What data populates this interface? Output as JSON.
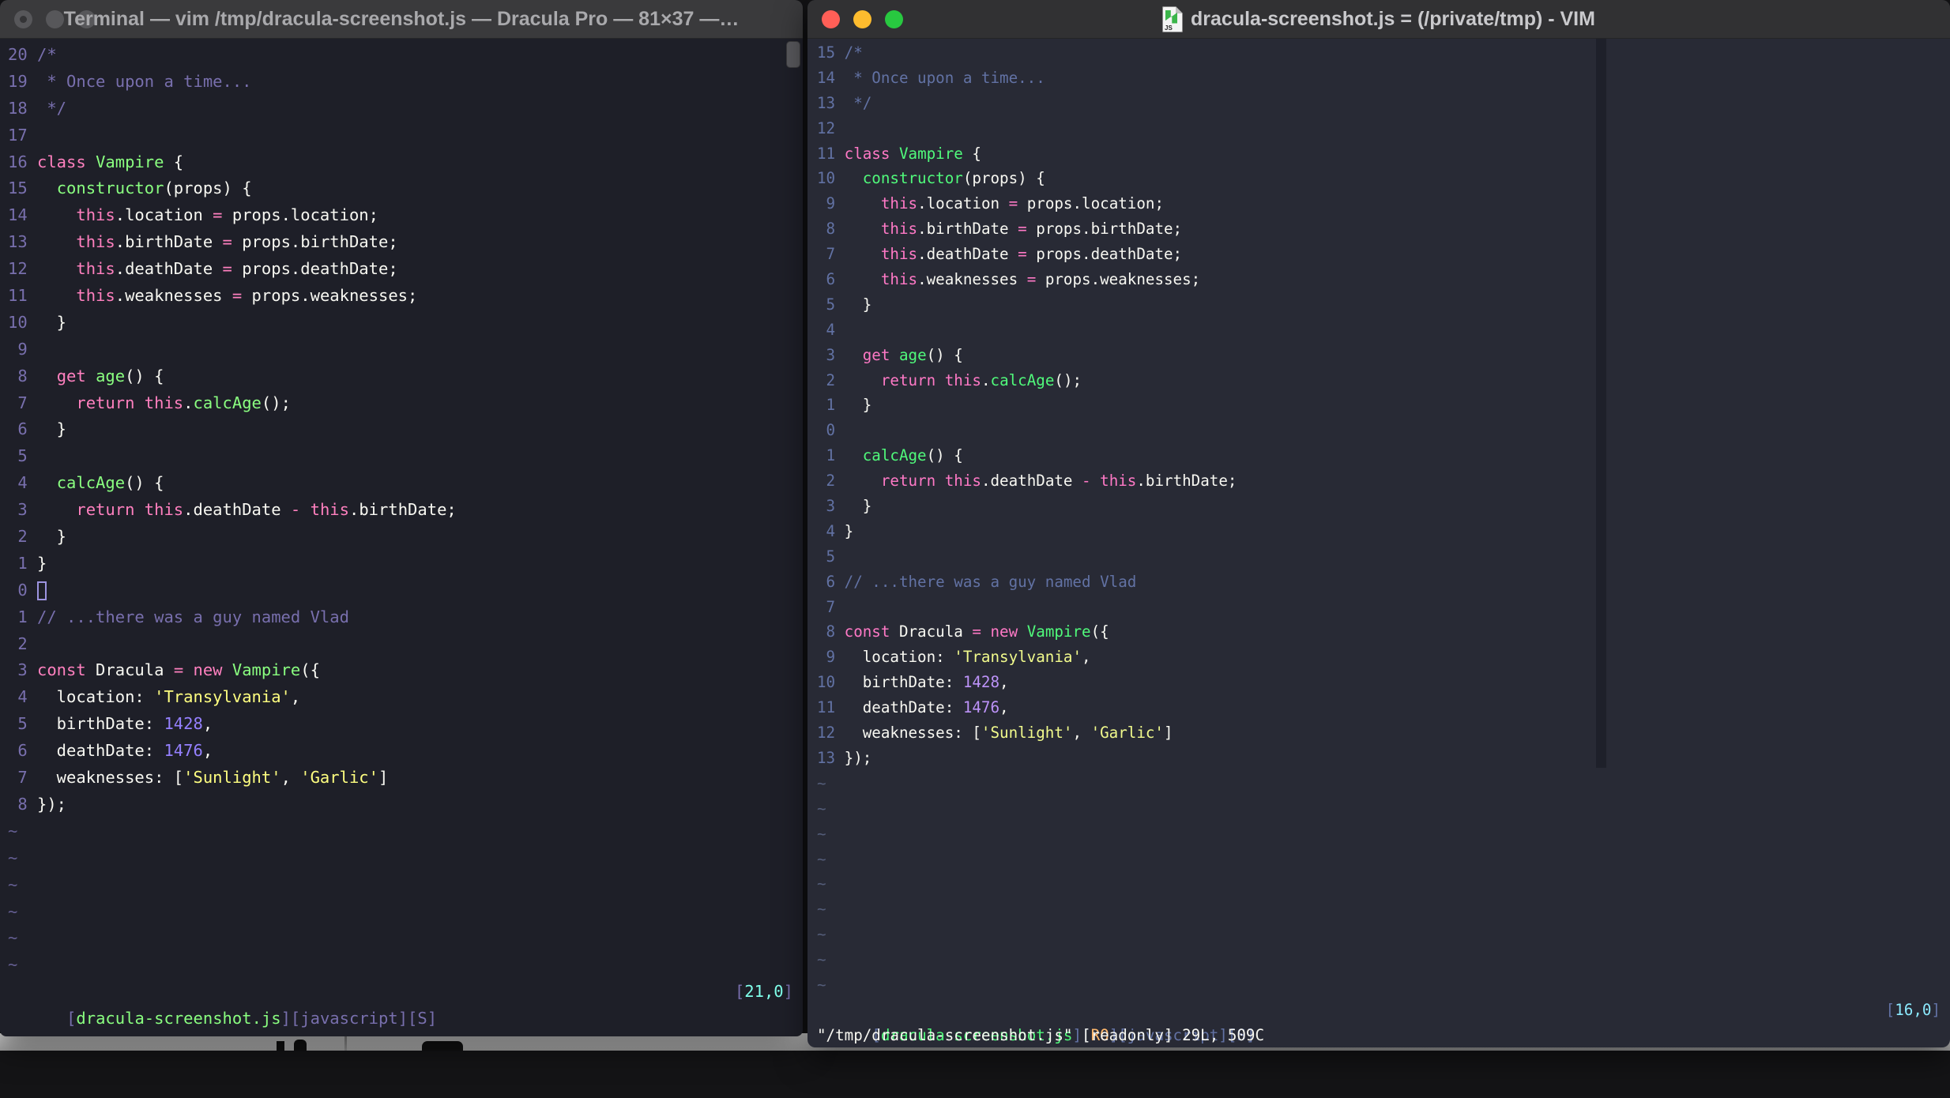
{
  "left_window": {
    "title": "Terminal — vim /tmp/dracula-screenshot.js — Dracula Pro — 81×37 —…",
    "palette": {
      "bg": "#1E1F28",
      "fg": "#F8F8F2",
      "comment": "#786FAD",
      "linenr": "#786FAD",
      "tilde": "#645E92",
      "pink": "#FF80BF",
      "green": "#8AFF80",
      "yellow": "#FFFF80",
      "purple": "#9580FF",
      "cyan": "#80FFEA",
      "orange": "#FFCA80"
    },
    "traffic_light_color": "#57575A",
    "lines": [
      {
        "n": "20",
        "s": [
          [
            "/*",
            "comment"
          ]
        ]
      },
      {
        "n": "19",
        "s": [
          [
            " * Once upon a time...",
            "comment"
          ]
        ]
      },
      {
        "n": "18",
        "s": [
          [
            " */",
            "comment"
          ]
        ]
      },
      {
        "n": "17",
        "s": []
      },
      {
        "n": "16",
        "s": [
          [
            "class",
            "pink"
          ],
          [
            " ",
            "fg"
          ],
          [
            "Vampire",
            "green"
          ],
          [
            " {",
            "fg"
          ]
        ]
      },
      {
        "n": "15",
        "s": [
          [
            "  ",
            "fg"
          ],
          [
            "constructor",
            "green"
          ],
          [
            "(props) {",
            "fg"
          ]
        ]
      },
      {
        "n": "14",
        "s": [
          [
            "    ",
            "fg"
          ],
          [
            "this",
            "pink"
          ],
          [
            ".location ",
            "fg"
          ],
          [
            "=",
            "pink"
          ],
          [
            " props.location;",
            "fg"
          ]
        ]
      },
      {
        "n": "13",
        "s": [
          [
            "    ",
            "fg"
          ],
          [
            "this",
            "pink"
          ],
          [
            ".birthDate ",
            "fg"
          ],
          [
            "=",
            "pink"
          ],
          [
            " props.birthDate;",
            "fg"
          ]
        ]
      },
      {
        "n": "12",
        "s": [
          [
            "    ",
            "fg"
          ],
          [
            "this",
            "pink"
          ],
          [
            ".deathDate ",
            "fg"
          ],
          [
            "=",
            "pink"
          ],
          [
            " props.deathDate;",
            "fg"
          ]
        ]
      },
      {
        "n": "11",
        "s": [
          [
            "    ",
            "fg"
          ],
          [
            "this",
            "pink"
          ],
          [
            ".weaknesses ",
            "fg"
          ],
          [
            "=",
            "pink"
          ],
          [
            " props.weaknesses;",
            "fg"
          ]
        ]
      },
      {
        "n": "10",
        "s": [
          [
            "  }",
            "fg"
          ]
        ]
      },
      {
        "n": " 9",
        "s": []
      },
      {
        "n": " 8",
        "s": [
          [
            "  ",
            "fg"
          ],
          [
            "get",
            "pink"
          ],
          [
            " ",
            "fg"
          ],
          [
            "age",
            "green"
          ],
          [
            "() {",
            "fg"
          ]
        ]
      },
      {
        "n": " 7",
        "s": [
          [
            "    ",
            "fg"
          ],
          [
            "return",
            "pink"
          ],
          [
            " ",
            "fg"
          ],
          [
            "this",
            "pink"
          ],
          [
            ".",
            "fg"
          ],
          [
            "calcAge",
            "green"
          ],
          [
            "();",
            "fg"
          ]
        ]
      },
      {
        "n": " 6",
        "s": [
          [
            "  }",
            "fg"
          ]
        ]
      },
      {
        "n": " 5",
        "s": []
      },
      {
        "n": " 4",
        "s": [
          [
            "  ",
            "fg"
          ],
          [
            "calcAge",
            "green"
          ],
          [
            "() {",
            "fg"
          ]
        ]
      },
      {
        "n": " 3",
        "s": [
          [
            "    ",
            "fg"
          ],
          [
            "return",
            "pink"
          ],
          [
            " ",
            "fg"
          ],
          [
            "this",
            "pink"
          ],
          [
            ".deathDate ",
            "fg"
          ],
          [
            "-",
            "pink"
          ],
          [
            " ",
            "fg"
          ],
          [
            "this",
            "pink"
          ],
          [
            ".birthDate;",
            "fg"
          ]
        ]
      },
      {
        "n": " 2",
        "s": [
          [
            "  }",
            "fg"
          ]
        ]
      },
      {
        "n": " 1",
        "s": [
          [
            "}",
            "fg"
          ]
        ]
      },
      {
        "n": " 0",
        "s": [],
        "cur": true
      },
      {
        "n": " 1",
        "s": [
          [
            "// ...there was a guy named Vlad",
            "comment"
          ]
        ]
      },
      {
        "n": " 2",
        "s": []
      },
      {
        "n": " 3",
        "s": [
          [
            "const",
            "pink"
          ],
          [
            " Dracula ",
            "fg"
          ],
          [
            "=",
            "pink"
          ],
          [
            " ",
            "fg"
          ],
          [
            "new",
            "pink"
          ],
          [
            " ",
            "fg"
          ],
          [
            "Vampire",
            "green"
          ],
          [
            "({",
            "fg"
          ]
        ]
      },
      {
        "n": " 4",
        "s": [
          [
            "  location: ",
            "fg"
          ],
          [
            "'Transylvania'",
            "yellow"
          ],
          [
            ",",
            "fg"
          ]
        ]
      },
      {
        "n": " 5",
        "s": [
          [
            "  birthDate: ",
            "fg"
          ],
          [
            "1428",
            "purple"
          ],
          [
            ",",
            "fg"
          ]
        ]
      },
      {
        "n": " 6",
        "s": [
          [
            "  deathDate: ",
            "fg"
          ],
          [
            "1476",
            "purple"
          ],
          [
            ",",
            "fg"
          ]
        ]
      },
      {
        "n": " 7",
        "s": [
          [
            "  weaknesses: [",
            "fg"
          ],
          [
            "'Sunlight'",
            "yellow"
          ],
          [
            ", ",
            "fg"
          ],
          [
            "'Garlic'",
            "yellow"
          ],
          [
            "]",
            "fg"
          ]
        ]
      },
      {
        "n": " 8",
        "s": [
          [
            "});",
            "fg"
          ]
        ]
      },
      {
        "t": 1
      },
      {
        "t": 1
      },
      {
        "t": 1
      },
      {
        "t": 1
      },
      {
        "t": 1
      },
      {
        "t": 1
      }
    ],
    "status_left": [
      [
        "[",
        "comment"
      ],
      [
        "dracula-screenshot.js",
        "green"
      ],
      [
        "][javascript][S]",
        "comment"
      ]
    ],
    "status_right": [
      [
        "[",
        "comment"
      ],
      [
        "21,0",
        "cyan"
      ],
      [
        "]",
        "comment"
      ]
    ],
    "cmdline": []
  },
  "right_window": {
    "title": "dracula-screenshot.js = (/private/tmp) - VIM",
    "icon_label": "JS",
    "palette": {
      "bg": "#282A35",
      "fg": "#F8F8F2",
      "comment": "#6272A4",
      "linenr": "#6272A4",
      "tilde": "#535C78",
      "pink": "#FF79C6",
      "green": "#50FA7B",
      "yellow": "#F1FA8C",
      "purple": "#BD93F9",
      "cyan": "#8BE9FD",
      "orange": "#FFB86C"
    },
    "traffic_lights": {
      "close": "#FF5F57",
      "minimize": "#FEBC2E",
      "zoom": "#28C840"
    },
    "lines": [
      {
        "n": "15",
        "s": [
          [
            "/*",
            "comment"
          ]
        ]
      },
      {
        "n": "14",
        "s": [
          [
            " * Once upon a time...",
            "comment"
          ]
        ]
      },
      {
        "n": "13",
        "s": [
          [
            " */",
            "comment"
          ]
        ]
      },
      {
        "n": "12",
        "s": []
      },
      {
        "n": "11",
        "s": [
          [
            "class",
            "pink"
          ],
          [
            " ",
            "fg"
          ],
          [
            "Vampire",
            "green"
          ],
          [
            " {",
            "fg"
          ]
        ]
      },
      {
        "n": "10",
        "s": [
          [
            "  ",
            "fg"
          ],
          [
            "constructor",
            "green"
          ],
          [
            "(props) {",
            "fg"
          ]
        ]
      },
      {
        "n": " 9",
        "s": [
          [
            "    ",
            "fg"
          ],
          [
            "this",
            "pink"
          ],
          [
            ".location ",
            "fg"
          ],
          [
            "=",
            "pink"
          ],
          [
            " props.location;",
            "fg"
          ]
        ]
      },
      {
        "n": " 8",
        "s": [
          [
            "    ",
            "fg"
          ],
          [
            "this",
            "pink"
          ],
          [
            ".birthDate ",
            "fg"
          ],
          [
            "=",
            "pink"
          ],
          [
            " props.birthDate;",
            "fg"
          ]
        ]
      },
      {
        "n": " 7",
        "s": [
          [
            "    ",
            "fg"
          ],
          [
            "this",
            "pink"
          ],
          [
            ".deathDate ",
            "fg"
          ],
          [
            "=",
            "pink"
          ],
          [
            " props.deathDate;",
            "fg"
          ]
        ]
      },
      {
        "n": " 6",
        "s": [
          [
            "    ",
            "fg"
          ],
          [
            "this",
            "pink"
          ],
          [
            ".weaknesses ",
            "fg"
          ],
          [
            "=",
            "pink"
          ],
          [
            " props.weaknesses;",
            "fg"
          ]
        ]
      },
      {
        "n": " 5",
        "s": [
          [
            "  }",
            "fg"
          ]
        ]
      },
      {
        "n": " 4",
        "s": []
      },
      {
        "n": " 3",
        "s": [
          [
            "  ",
            "fg"
          ],
          [
            "get",
            "pink"
          ],
          [
            " ",
            "fg"
          ],
          [
            "age",
            "green"
          ],
          [
            "() {",
            "fg"
          ]
        ]
      },
      {
        "n": " 2",
        "s": [
          [
            "    ",
            "fg"
          ],
          [
            "return",
            "pink"
          ],
          [
            " ",
            "fg"
          ],
          [
            "this",
            "pink"
          ],
          [
            ".",
            "fg"
          ],
          [
            "calcAge",
            "green"
          ],
          [
            "();",
            "fg"
          ]
        ]
      },
      {
        "n": " 1",
        "s": [
          [
            "  }",
            "fg"
          ]
        ]
      },
      {
        "n": " 0",
        "s": []
      },
      {
        "n": " 1",
        "s": [
          [
            "  ",
            "fg"
          ],
          [
            "calcAge",
            "green"
          ],
          [
            "() {",
            "fg"
          ]
        ]
      },
      {
        "n": " 2",
        "s": [
          [
            "    ",
            "fg"
          ],
          [
            "return",
            "pink"
          ],
          [
            " ",
            "fg"
          ],
          [
            "this",
            "pink"
          ],
          [
            ".deathDate ",
            "fg"
          ],
          [
            "-",
            "pink"
          ],
          [
            " ",
            "fg"
          ],
          [
            "this",
            "pink"
          ],
          [
            ".birthDate;",
            "fg"
          ]
        ]
      },
      {
        "n": " 3",
        "s": [
          [
            "  }",
            "fg"
          ]
        ]
      },
      {
        "n": " 4",
        "s": [
          [
            "}",
            "fg"
          ]
        ]
      },
      {
        "n": " 5",
        "s": []
      },
      {
        "n": " 6",
        "s": [
          [
            "// ...there was a guy named Vlad",
            "comment"
          ]
        ]
      },
      {
        "n": " 7",
        "s": []
      },
      {
        "n": " 8",
        "s": [
          [
            "const",
            "pink"
          ],
          [
            " Dracula ",
            "fg"
          ],
          [
            "=",
            "pink"
          ],
          [
            " ",
            "fg"
          ],
          [
            "new",
            "pink"
          ],
          [
            " ",
            "fg"
          ],
          [
            "Vampire",
            "green"
          ],
          [
            "({",
            "fg"
          ]
        ]
      },
      {
        "n": " 9",
        "s": [
          [
            "  location: ",
            "fg"
          ],
          [
            "'Transylvania'",
            "yellow"
          ],
          [
            ",",
            "fg"
          ]
        ]
      },
      {
        "n": "10",
        "s": [
          [
            "  birthDate: ",
            "fg"
          ],
          [
            "1428",
            "purple"
          ],
          [
            ",",
            "fg"
          ]
        ]
      },
      {
        "n": "11",
        "s": [
          [
            "  deathDate: ",
            "fg"
          ],
          [
            "1476",
            "purple"
          ],
          [
            ",",
            "fg"
          ]
        ]
      },
      {
        "n": "12",
        "s": [
          [
            "  weaknesses: [",
            "fg"
          ],
          [
            "'Sunlight'",
            "yellow"
          ],
          [
            ", ",
            "fg"
          ],
          [
            "'Garlic'",
            "yellow"
          ],
          [
            "]",
            "fg"
          ]
        ]
      },
      {
        "n": "13",
        "s": [
          [
            "});",
            "fg"
          ]
        ]
      },
      {
        "t": 1
      },
      {
        "t": 1
      },
      {
        "t": 1
      },
      {
        "t": 1
      },
      {
        "t": 1
      },
      {
        "t": 1
      },
      {
        "t": 1
      },
      {
        "t": 1
      },
      {
        "t": 1
      }
    ],
    "status_left": [
      [
        "[",
        "comment"
      ],
      [
        "dracula-screenshot.js",
        "green"
      ],
      [
        "][",
        "comment"
      ],
      [
        "RO",
        "orange"
      ],
      [
        "][javascript][S]",
        "comment"
      ]
    ],
    "status_right": [
      [
        "[",
        "comment"
      ],
      [
        "16,0",
        "cyan"
      ],
      [
        "]",
        "comment"
      ]
    ],
    "cmdline": [
      [
        "\"/tmp/dracula-screenshot.js\" [readonly] 29L, 509C",
        "fg"
      ]
    ]
  }
}
